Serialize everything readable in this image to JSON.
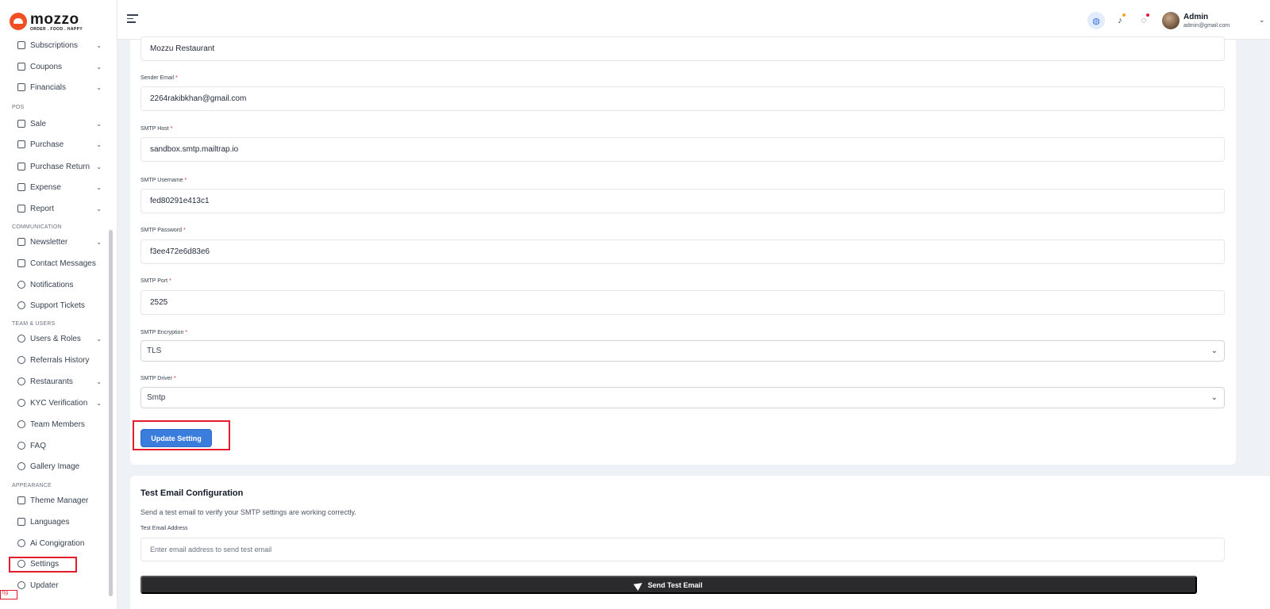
{
  "brand": {
    "name": "mozzo",
    "tagline": "ORDER . FOOD . HAPPY"
  },
  "sidebar": {
    "items": [
      {
        "label": "Subscriptions",
        "icon": "package-icon",
        "chev": "⌄"
      },
      {
        "label": "Coupons",
        "icon": "gift-icon",
        "chev": "⌄"
      },
      {
        "label": "Financials",
        "icon": "wallet-icon",
        "chev": "⌄"
      },
      {
        "label": "Sale",
        "icon": "bag-icon",
        "chev": "⌄"
      },
      {
        "label": "Purchase",
        "icon": "bag-icon",
        "chev": "⌄"
      },
      {
        "label": "Purchase Return",
        "icon": "bag-icon",
        "chev": "⌄"
      },
      {
        "label": "Expense",
        "icon": "bag-icon",
        "chev": "⌄"
      },
      {
        "label": "Report",
        "icon": "bag-icon",
        "chev": "⌄"
      },
      {
        "label": "Newsletter",
        "icon": "mail-icon",
        "chev": "⌄"
      },
      {
        "label": "Contact Messages",
        "icon": "mail-icon",
        "chev": ""
      },
      {
        "label": "Notifications",
        "icon": "bell-icon",
        "chev": ""
      },
      {
        "label": "Support Tickets",
        "icon": "chat-icon",
        "chev": ""
      },
      {
        "label": "Users & Roles",
        "icon": "database-icon",
        "chev": "⌄"
      },
      {
        "label": "Referrals History",
        "icon": "users-icon",
        "chev": ""
      },
      {
        "label": "Restaurants",
        "icon": "users-icon",
        "chev": "⌄"
      },
      {
        "label": "KYC Verification",
        "icon": "check-badge-icon",
        "chev": "⌄"
      },
      {
        "label": "Team Members",
        "icon": "users-icon",
        "chev": ""
      },
      {
        "label": "FAQ",
        "icon": "users-icon",
        "chev": ""
      },
      {
        "label": "Gallery Image",
        "icon": "users-icon",
        "chev": ""
      },
      {
        "label": "Theme Manager",
        "icon": "palette-icon",
        "chev": ""
      },
      {
        "label": "Languages",
        "icon": "translate-icon",
        "chev": ""
      },
      {
        "label": "Ai Congigration",
        "icon": "gear-icon",
        "chev": ""
      },
      {
        "label": "Settings",
        "icon": "gear-icon",
        "chev": ""
      },
      {
        "label": "Updater",
        "icon": "refresh-icon",
        "chev": ""
      }
    ],
    "sections": [
      "POS",
      "COMMUNICATION",
      "TEAM & USERS",
      "APPEARANCE"
    ],
    "tiny_tag": "f(g"
  },
  "header": {
    "user_name": "Admin",
    "user_email": "admin@gmail.com",
    "notification_dot_color": "#f5a623",
    "chat_dot_color": "#e11d2e",
    "chevron": "⌄"
  },
  "form": {
    "sender_name_value": "Mozzu Restaurant",
    "fields": [
      {
        "label": "Sender Email",
        "value": "2264rakibkhan@gmail.com"
      },
      {
        "label": "SMTP Host",
        "value": "sandbox.smtp.mailtrap.io"
      },
      {
        "label": "SMTP Username",
        "value": "fed80291e413c1"
      },
      {
        "label": "SMTP Password",
        "value": "f3ee472e6d83e6"
      },
      {
        "label": "SMTP Port",
        "value": "2525"
      }
    ],
    "encryption": {
      "label": "SMTP Encryption",
      "value": "TLS"
    },
    "driver": {
      "label": "SMTP Driver",
      "value": "Smtp"
    },
    "required_mark": "*",
    "select_chevron": "⌄",
    "update_label": "Update Setting"
  },
  "test": {
    "title": "Test Email Configuration",
    "description": "Send a test email to verify your SMTP settings are working correctly.",
    "field_label": "Test Email Address",
    "placeholder": "Enter email address to send test email",
    "send_label": "Send Test Email"
  },
  "colors": {
    "accent": "#3b7ddd",
    "brand": "#f04e23",
    "highlight": "#e11d2e"
  }
}
